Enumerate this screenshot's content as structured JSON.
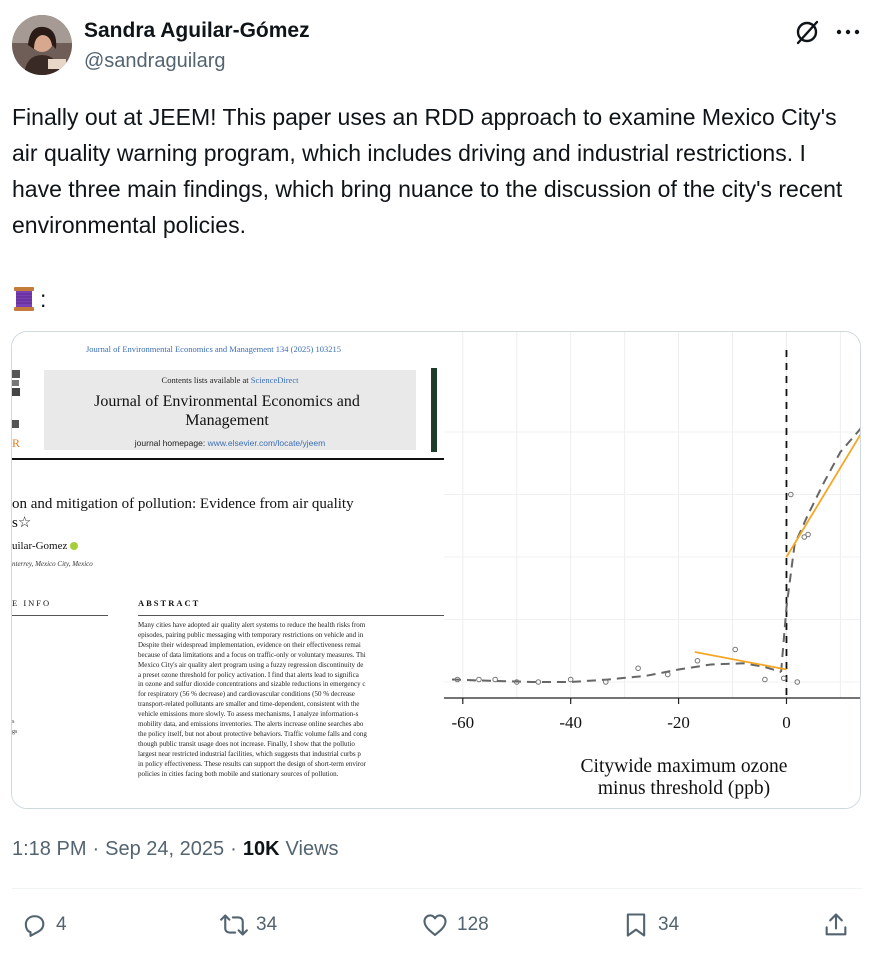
{
  "author": {
    "name": "Sandra Aguilar-Gómez",
    "handle": "@sandraguilarg"
  },
  "post": {
    "text": "Finally out at JEEM! This paper uses an RDD approach to examine Mexico City's air quality warning program, which includes driving and industrial restrictions. I have three main findings, which bring nuance to the discussion of the city's recent environmental policies.",
    "thread_suffix": ":",
    "thread_emoji": "spool-of-thread-icon"
  },
  "paper": {
    "journal_ref": "Journal of Environmental Economics and Management 134 (2025) 103215",
    "contents_prefix": "Contents lists available at ",
    "contents_link": "ScienceDirect",
    "journal_title_line1": "Journal of Environmental Economics and",
    "journal_title_line2": "Management",
    "homepage_prefix": "journal homepage: ",
    "homepage_link": "www.elsevier.com/locate/yjeem",
    "left_logo_letter": "R",
    "article_title_line1": "on and mitigation of pollution: Evidence from air quality",
    "article_title_line2": "s☆",
    "author_name": "uilar-Gomez",
    "affiliation": "nterrey, Mexico City, Mexico",
    "info_heading": "E  INFO",
    "abstract_heading": "ABSTRACT",
    "abstract_lines": [
      "Many cities have adopted air quality alert systems to reduce the health risks from",
      "episodes, pairing public messaging with temporary restrictions on vehicle and in",
      "Despite their widespread implementation, evidence on their effectiveness remai",
      "because of data limitations and a focus on traffic-only or voluntary measures. Thi",
      "Mexico City's air quality alert program using a fuzzy regression discontinuity de",
      "a preset ozone threshold for policy activation. I find that alerts lead to significa",
      "in ozone and sulfur dioxide concentrations and sizable reductions in emergency c",
      "for respiratory (56 % decrease) and cardiovascular conditions (50 % decrease",
      "transport-related pollutants are smaller and time-dependent, consistent with the",
      "vehicle emissions more slowly. To assess mechanisms, I analyze information-s",
      "mobility data, and emissions inventories. The alerts increase online searches abo",
      "the policy itself, but not about protective behaviors. Traffic volume falls and cong",
      "though public transit usage does not increase. Finally, I show that the pollutio",
      "largest near restricted industrial facilities, which suggests that industrial curbs p",
      "in policy effectiveness. These results can support the design of short-term enviror",
      "policies in cities facing both mobile and stationary sources of pollution."
    ],
    "side_bits": [
      "s",
      "gs"
    ]
  },
  "chart_data": {
    "type": "scatter",
    "xlabel_line1": "Citywide maximum ozone",
    "xlabel_line2": "minus threshold (ppb)",
    "ylabel": "",
    "x_ticks": [
      "-60",
      "-40",
      "-20",
      "0"
    ],
    "xlim": [
      -62,
      14
    ],
    "cutoff": 0,
    "points": [
      {
        "x": -61,
        "y": 0.01
      },
      {
        "x": -57,
        "y": 0.01
      },
      {
        "x": -54,
        "y": 0.01
      },
      {
        "x": -50,
        "y": 0.0
      },
      {
        "x": -46,
        "y": 0.0
      },
      {
        "x": -40,
        "y": 0.01
      },
      {
        "x": -33.5,
        "y": 0.0
      },
      {
        "x": -27.5,
        "y": 0.055
      },
      {
        "x": -22,
        "y": 0.03
      },
      {
        "x": -16.5,
        "y": 0.085
      },
      {
        "x": -9.5,
        "y": 0.13
      },
      {
        "x": -4,
        "y": 0.01
      },
      {
        "x": -0.5,
        "y": 0.015
      },
      {
        "x": 2,
        "y": 0.0
      },
      {
        "x": 0.8,
        "y": 0.75
      },
      {
        "x": 3.3,
        "y": 0.58
      },
      {
        "x": 4.0,
        "y": 0.59
      }
    ],
    "fit_left": {
      "x": [
        -17,
        0
      ],
      "y": [
        0.12,
        0.05
      ],
      "color": "#f5a623"
    },
    "fit_right": {
      "x": [
        0,
        14
      ],
      "y": [
        0.5,
        1.0
      ],
      "color": "#f5a623"
    },
    "dashed_curve": [
      [
        -62,
        0.01
      ],
      [
        -55,
        0.005
      ],
      [
        -47,
        0.0
      ],
      [
        -40,
        0.0
      ],
      [
        -33,
        0.01
      ],
      [
        -26,
        0.025
      ],
      [
        -20,
        0.05
      ],
      [
        -14,
        0.07
      ],
      [
        -8,
        0.075
      ],
      [
        -4,
        0.06
      ],
      [
        -1,
        0.04
      ],
      [
        0,
        0.3
      ],
      [
        1.5,
        0.55
      ],
      [
        4,
        0.67
      ],
      [
        7,
        0.8
      ],
      [
        10,
        0.92
      ],
      [
        14,
        1.02
      ]
    ]
  },
  "meta": {
    "time": "1:18 PM",
    "date": "Sep 24, 2025",
    "views_count": "10K",
    "views_label": "Views"
  },
  "actions": {
    "replies": "4",
    "reposts": "34",
    "likes": "128",
    "bookmarks": "34"
  }
}
